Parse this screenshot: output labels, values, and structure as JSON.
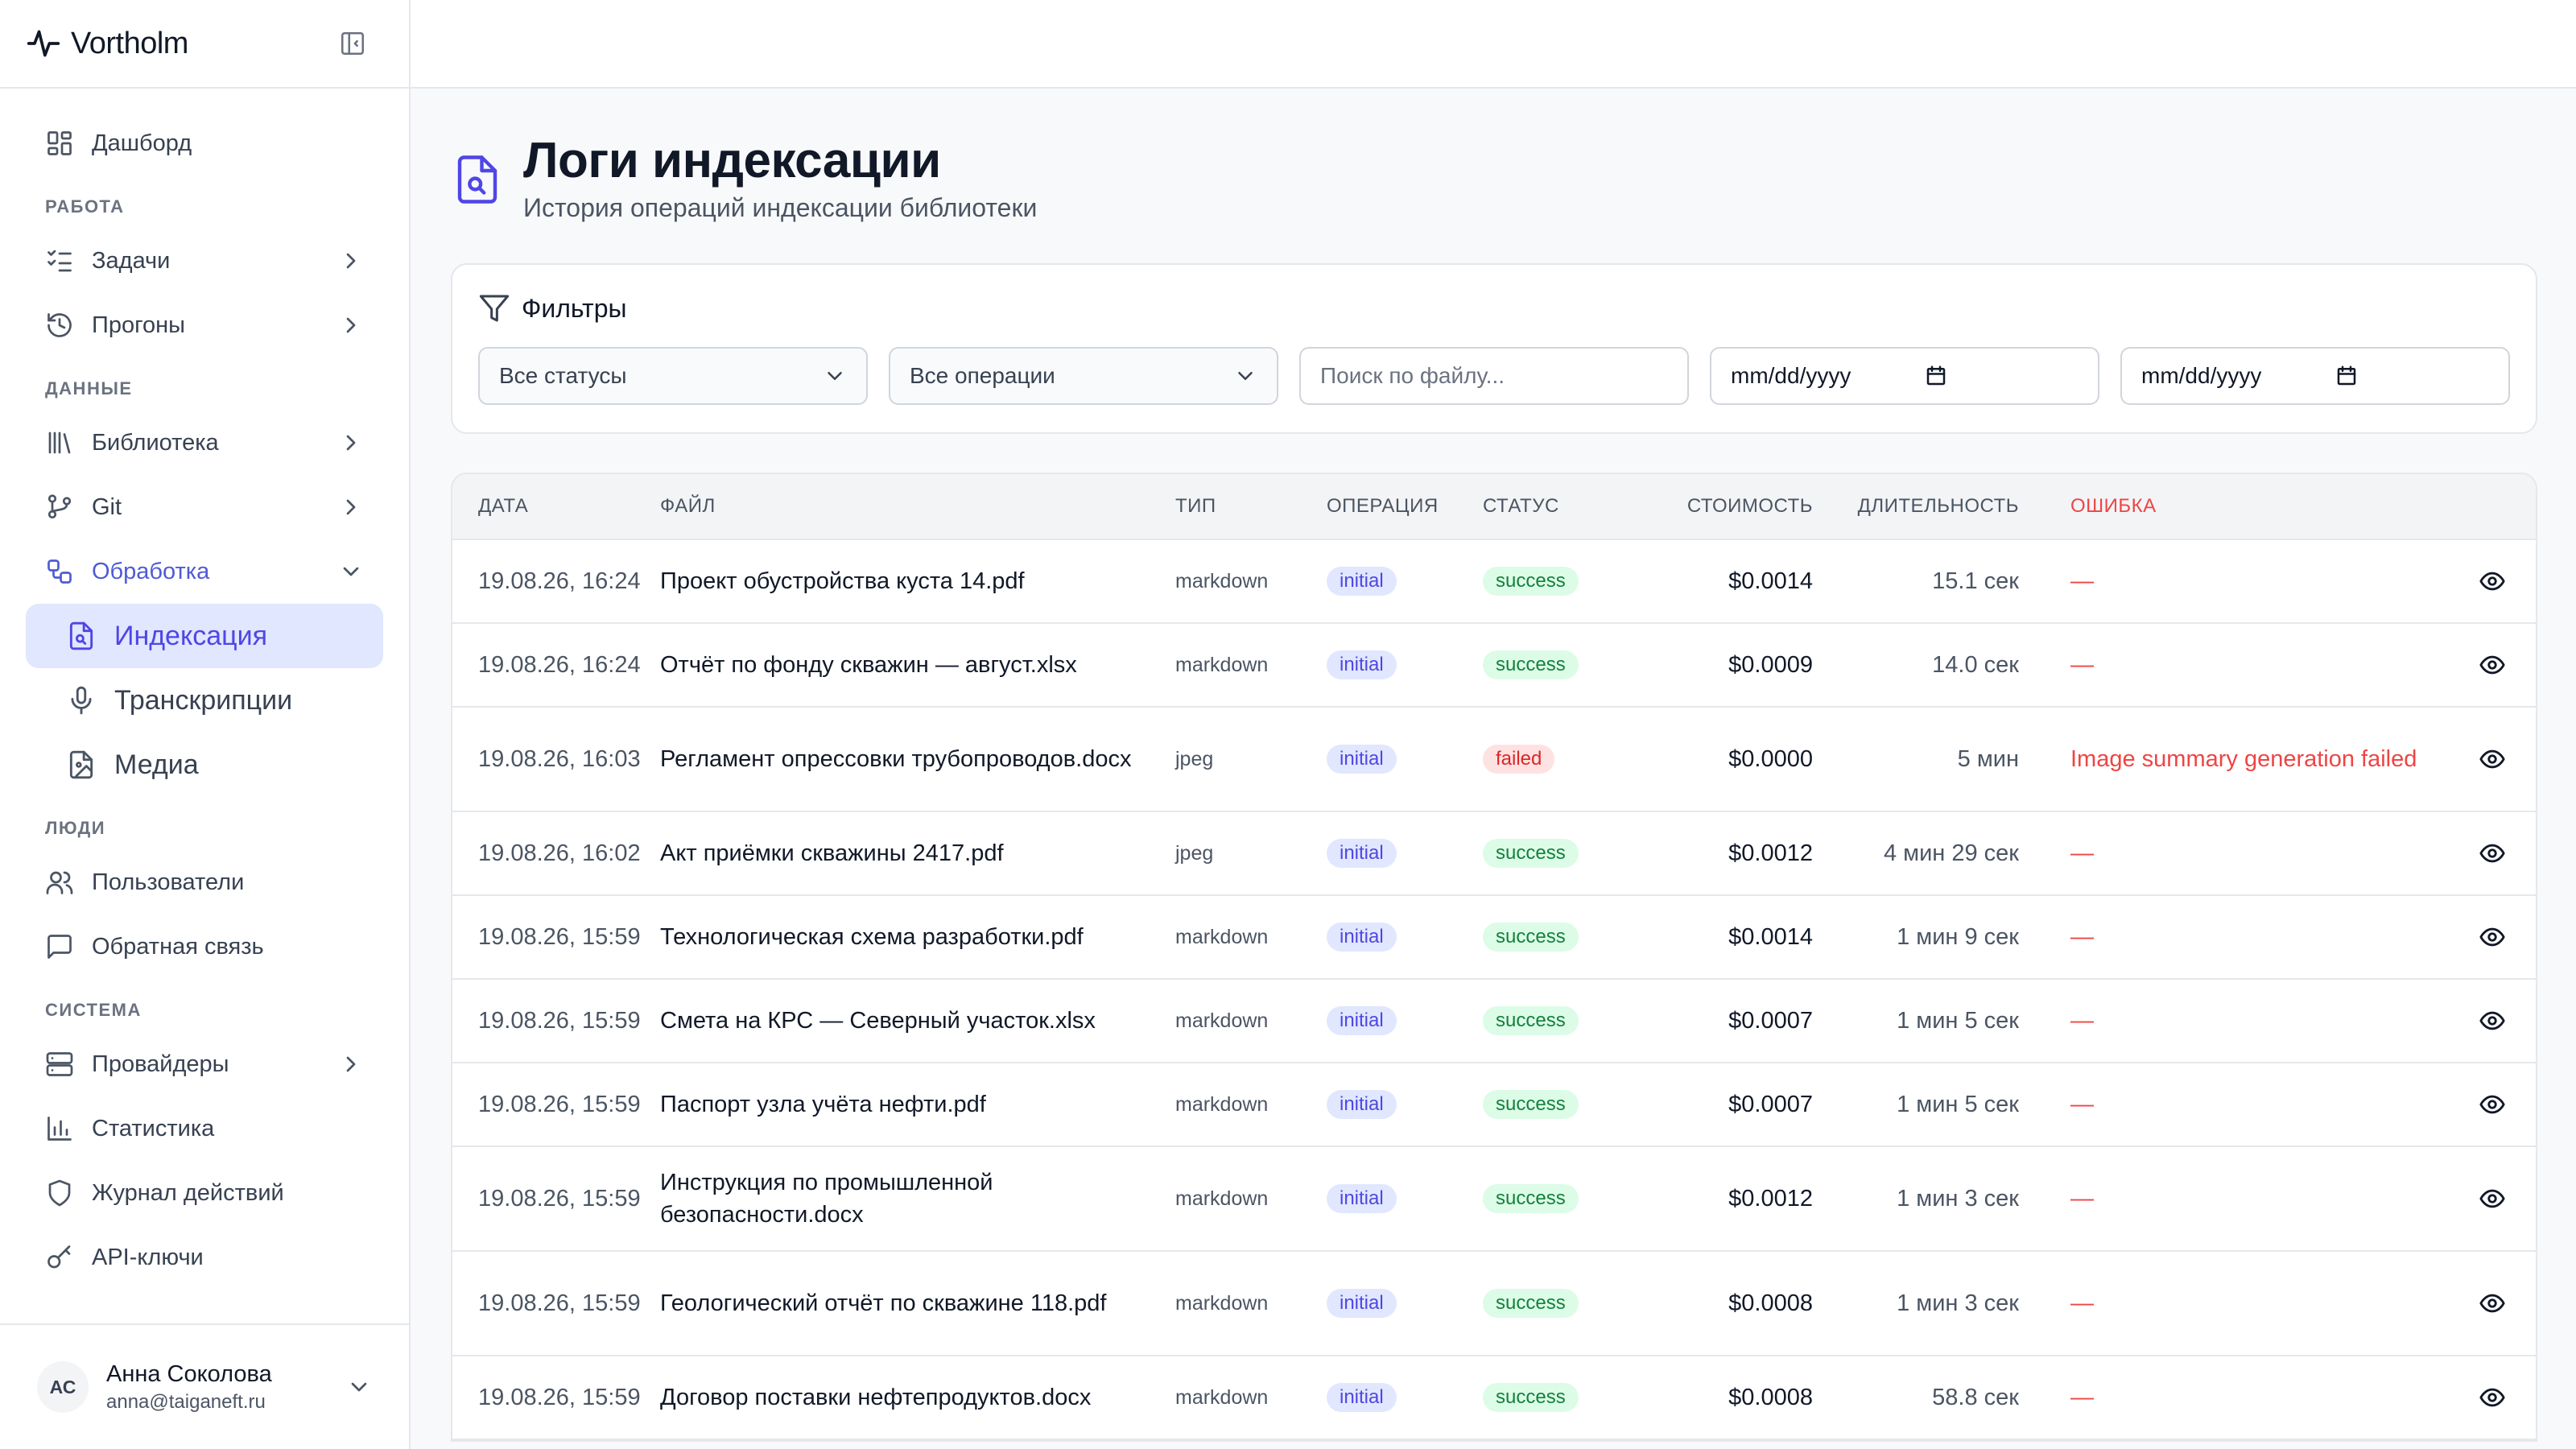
{
  "brand": {
    "name": "Vortholm"
  },
  "sidebar": {
    "top_item": {
      "label": "Дашборд"
    },
    "sections": {
      "work": "РАБОТА",
      "data": "ДАННЫЕ",
      "people": "ЛЮДИ",
      "system": "СИСТЕМА"
    },
    "work_items": [
      {
        "label": "Задачи"
      },
      {
        "label": "Прогоны"
      }
    ],
    "data_items": [
      {
        "label": "Библиотека"
      },
      {
        "label": "Git"
      },
      {
        "label": "Обработка"
      }
    ],
    "processing_sub": [
      {
        "label": "Индексация"
      },
      {
        "label": "Транскрипции"
      },
      {
        "label": "Медиа"
      }
    ],
    "people_items": [
      {
        "label": "Пользователи"
      },
      {
        "label": "Обратная связь"
      }
    ],
    "system_items": [
      {
        "label": "Провайдеры"
      },
      {
        "label": "Статистика"
      },
      {
        "label": "Журнал действий"
      },
      {
        "label": "API-ключи"
      }
    ]
  },
  "user": {
    "initials": "АС",
    "name": "Анна Соколова",
    "email": "anna@taiganeft.ru"
  },
  "page": {
    "title": "Логи индексации",
    "subtitle": "История операций индексации библиотеки"
  },
  "filters": {
    "title": "Фильтры",
    "status_select": "Все статусы",
    "operation_select": "Все операции",
    "search_placeholder": "Поиск по файлу...",
    "date_from": "mm/dd/yyyy",
    "date_to": "mm/dd/yyyy"
  },
  "table": {
    "headers": {
      "date": "ДАТА",
      "file": "ФАЙЛ",
      "type": "ТИП",
      "operation": "ОПЕРАЦИЯ",
      "status": "СТАТУС",
      "cost": "СТОИМОСТЬ",
      "duration": "ДЛИТЕЛЬНОСТЬ",
      "error": "ОШИБКА"
    },
    "rows": [
      {
        "date": "19.08.26, 16:24",
        "file": "Проект обустройства куста 14.pdf",
        "type": "markdown",
        "operation": "initial",
        "status": "success",
        "cost": "$0.0014",
        "duration": "15.1 сек",
        "error": "—"
      },
      {
        "date": "19.08.26, 16:24",
        "file": "Отчёт по фонду скважин — август.xlsx",
        "type": "markdown",
        "operation": "initial",
        "status": "success",
        "cost": "$0.0009",
        "duration": "14.0 сек",
        "error": "—"
      },
      {
        "date": "19.08.26, 16:03",
        "file": "Регламент опрессовки трубопроводов.docx",
        "type": "jpeg",
        "operation": "initial",
        "status": "failed",
        "cost": "$0.0000",
        "duration": "5 мин",
        "error": "Image summary generation failed"
      },
      {
        "date": "19.08.26, 16:02",
        "file": "Акт приёмки скважины 2417.pdf",
        "type": "jpeg",
        "operation": "initial",
        "status": "success",
        "cost": "$0.0012",
        "duration": "4 мин 29 сек",
        "error": "—"
      },
      {
        "date": "19.08.26, 15:59",
        "file": "Технологическая схема разработки.pdf",
        "type": "markdown",
        "operation": "initial",
        "status": "success",
        "cost": "$0.0014",
        "duration": "1 мин 9 сек",
        "error": "—"
      },
      {
        "date": "19.08.26, 15:59",
        "file": "Смета на КРС — Северный участок.xlsx",
        "type": "markdown",
        "operation": "initial",
        "status": "success",
        "cost": "$0.0007",
        "duration": "1 мин 5 сек",
        "error": "—"
      },
      {
        "date": "19.08.26, 15:59",
        "file": "Паспорт узла учёта нефти.pdf",
        "type": "markdown",
        "operation": "initial",
        "status": "success",
        "cost": "$0.0007",
        "duration": "1 мин 5 сек",
        "error": "—"
      },
      {
        "date": "19.08.26, 15:59",
        "file": "Инструкция по промышленной безопасности.docx",
        "type": "markdown",
        "operation": "initial",
        "status": "success",
        "cost": "$0.0012",
        "duration": "1 мин 3 сек",
        "error": "—"
      },
      {
        "date": "19.08.26, 15:59",
        "file": "Геологический отчёт по скважине 118.pdf",
        "type": "markdown",
        "operation": "initial",
        "status": "success",
        "cost": "$0.0008",
        "duration": "1 мин 3 сек",
        "error": "—"
      },
      {
        "date": "19.08.26, 15:59",
        "file": "Договор поставки нефтепродуктов.docx",
        "type": "markdown",
        "operation": "initial",
        "status": "success",
        "cost": "$0.0008",
        "duration": "58.8 сек",
        "error": "—"
      }
    ]
  },
  "colors": {
    "accent": "#4f46e5",
    "success": "#15803d",
    "failed": "#dc2626",
    "error_text": "#ef4444"
  }
}
